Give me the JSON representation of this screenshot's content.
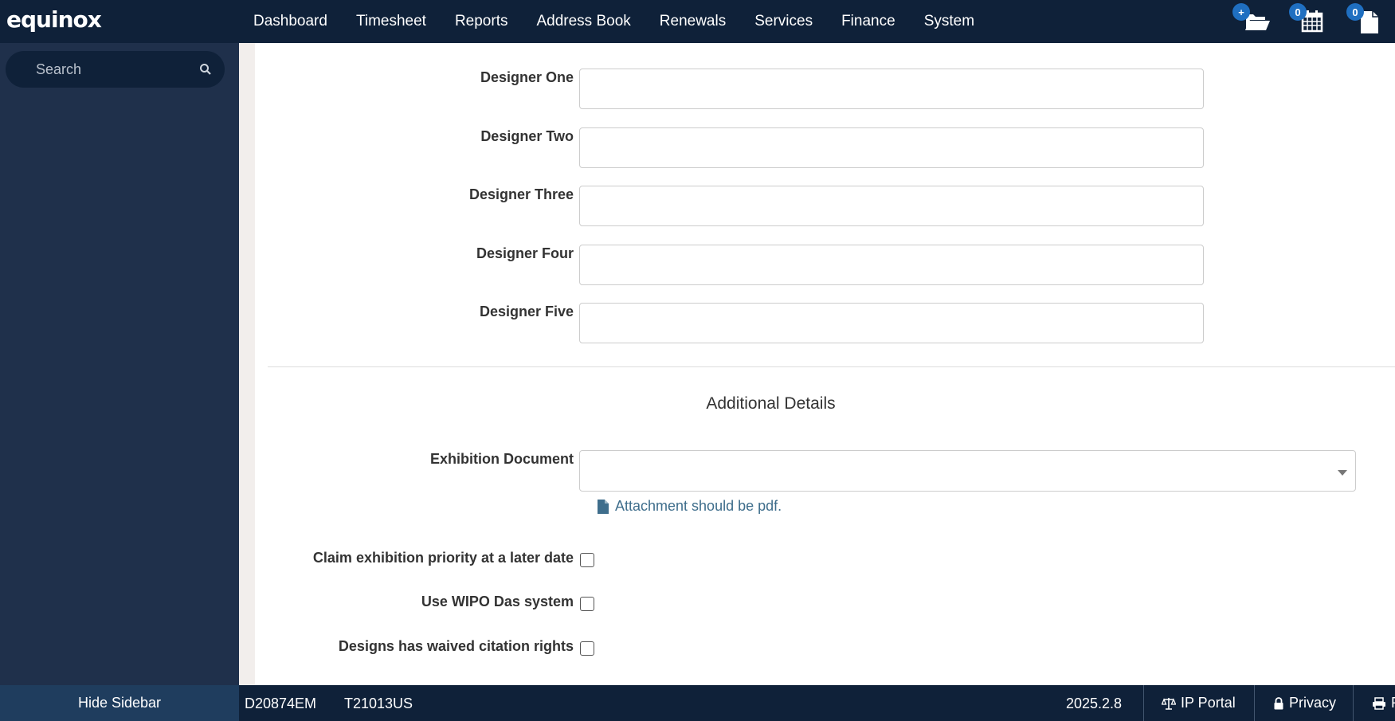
{
  "app": {
    "logo": "equinox"
  },
  "nav": {
    "items": [
      "Dashboard",
      "Timesheet",
      "Reports",
      "Address Book",
      "Renewals",
      "Services",
      "Finance",
      "System"
    ],
    "icons": [
      {
        "name": "folder-open-icon",
        "badge": "+"
      },
      {
        "name": "calendar-icon",
        "badge": "0"
      },
      {
        "name": "document-icon",
        "badge": "0"
      }
    ]
  },
  "sidebar": {
    "search_placeholder": "Search"
  },
  "form": {
    "designers": [
      {
        "label": "Designer One",
        "value": ""
      },
      {
        "label": "Designer Two",
        "value": ""
      },
      {
        "label": "Designer Three",
        "value": ""
      },
      {
        "label": "Designer Four",
        "value": ""
      },
      {
        "label": "Designer Five",
        "value": ""
      }
    ],
    "section_title": "Additional Details",
    "exhibition_document": {
      "label": "Exhibition Document",
      "value": "",
      "hint": "Attachment should be pdf."
    },
    "checkboxes": [
      {
        "label": "Claim exhibition priority at a later date",
        "checked": false
      },
      {
        "label": "Use WIPO Das system",
        "checked": false
      },
      {
        "label": "Designs has waived citation rights",
        "checked": false
      }
    ]
  },
  "footer": {
    "hide_sidebar": "Hide Sidebar",
    "code1": "D20874EM",
    "code2": "T21013US",
    "version": "2025.2.8",
    "ip_portal": "IP Portal",
    "privacy": "Privacy",
    "print_initial": "P"
  },
  "colors": {
    "topbar": "#0f2139",
    "sidebar": "#1f304b",
    "badge": "#1f6fc1",
    "hint": "#3f6e8c"
  }
}
